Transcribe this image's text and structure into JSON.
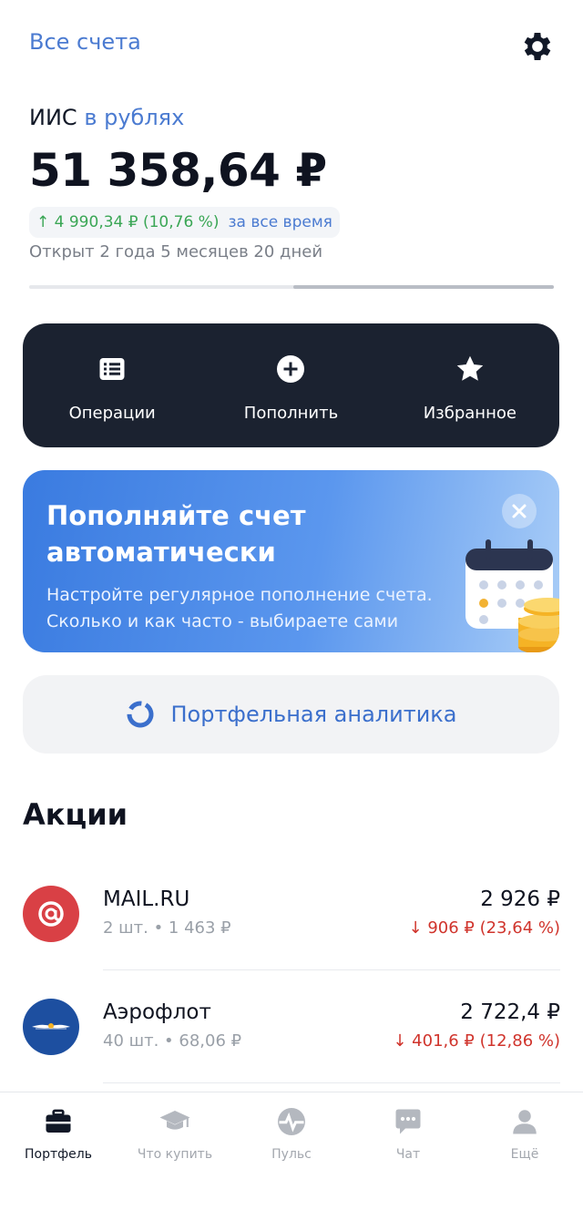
{
  "header": {
    "all_accounts": "Все счета",
    "settings_icon": "gear-icon"
  },
  "account": {
    "name": "ИИС",
    "currency_note": "в рублях",
    "balance": "51 358,64 ₽",
    "profit": "↑ 4 990,34 ₽ (10,76 %)",
    "profit_period": "за все время",
    "opened": "Открыт 2 года 5 месяцев 20 дней"
  },
  "actions": [
    {
      "label": "Операции",
      "icon": "list-icon"
    },
    {
      "label": "Пополнить",
      "icon": "plus-circle-icon"
    },
    {
      "label": "Избранное",
      "icon": "star-icon"
    }
  ],
  "promo": {
    "title": "Пополняйте счет автоматически",
    "text": "Настройте регулярное пополнение счета. Сколько и как часто - выбираете сами",
    "close_icon": "close-icon",
    "art_icon": "calendar-coins-icon"
  },
  "analytics": {
    "label": "Портфельная аналитика",
    "icon": "donut-chart-icon"
  },
  "stocks_section": {
    "title": "Акции",
    "items": [
      {
        "name": "MAIL.RU",
        "qty": "2 шт. • 1 463 ₽",
        "value": "2 926 ₽",
        "change": "↓ 906 ₽ (23,64 %)",
        "color": "#d94045"
      },
      {
        "name": "Аэрофлот",
        "qty": "40 шт. • 68,06 ₽",
        "value": "2 722,4 ₽",
        "change": "↓ 401,6 ₽ (12,86 %)",
        "color": "#1d4fa0"
      }
    ]
  },
  "tabbar": [
    {
      "label": "Портфель",
      "icon": "briefcase-icon",
      "active": true
    },
    {
      "label": "Что купить",
      "icon": "graduation-cap-icon",
      "active": false
    },
    {
      "label": "Пульс",
      "icon": "pulse-icon",
      "active": false
    },
    {
      "label": "Чат",
      "icon": "chat-icon",
      "active": false
    },
    {
      "label": "Ещё",
      "icon": "user-icon",
      "active": false
    }
  ],
  "colors": {
    "accent_blue": "#4b7bd1",
    "gain_green": "#3aa655",
    "loss_red": "#d0342c",
    "dark_panel": "#1b2230"
  }
}
